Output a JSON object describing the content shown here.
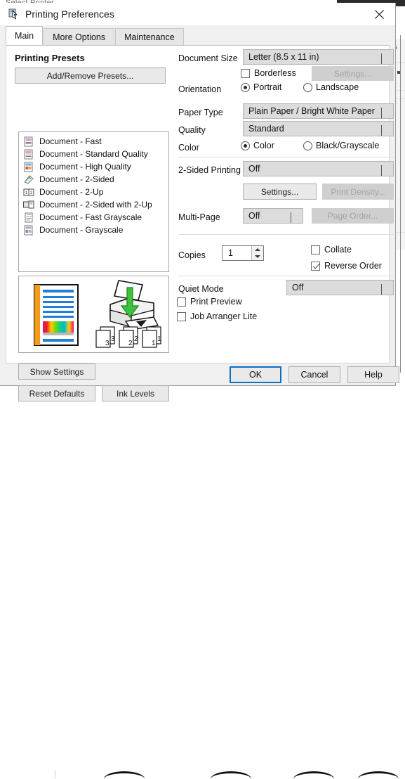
{
  "background": {
    "top_label": "Select Printer",
    "side_glyph": "s"
  },
  "window": {
    "title": "Printing Preferences",
    "title_icon": "printer-icon",
    "close_icon": "close-icon"
  },
  "tabs": [
    {
      "label": "Main",
      "active": true
    },
    {
      "label": "More Options",
      "active": false
    },
    {
      "label": "Maintenance",
      "active": false
    }
  ],
  "left_panel": {
    "section_title": "Printing Presets",
    "add_remove_label": "Add/Remove Presets...",
    "presets": [
      {
        "label": "Document - Fast",
        "icon": "preset-doc-fast-icon"
      },
      {
        "label": "Document - Standard Quality",
        "icon": "preset-doc-standard-icon"
      },
      {
        "label": "Document - High Quality",
        "icon": "preset-doc-high-icon"
      },
      {
        "label": "Document - 2-Sided",
        "icon": "preset-doc-2sided-icon"
      },
      {
        "label": "Document - 2-Up",
        "icon": "preset-doc-2up-icon"
      },
      {
        "label": "Document - 2-Sided with 2-Up",
        "icon": "preset-doc-2sided-2up-icon"
      },
      {
        "label": "Document - Fast Grayscale",
        "icon": "preset-doc-fast-gray-icon"
      },
      {
        "label": "Document - Grayscale",
        "icon": "preset-doc-gray-icon"
      }
    ],
    "preview": {
      "page_labels": [
        "3",
        "3",
        "2",
        "2",
        "1",
        "1"
      ],
      "printer_icon": "printer-illustration",
      "document_icon": "document-preview-illustration"
    },
    "show_settings_label": "Show Settings",
    "reset_defaults_label": "Reset Defaults",
    "ink_levels_label": "Ink Levels"
  },
  "right_panel": {
    "document_size": {
      "label": "Document Size",
      "value": "Letter (8.5 x 11 in)"
    },
    "borderless": {
      "label": "Borderless",
      "checked": false,
      "settings_label": "Settings...",
      "settings_disabled": true
    },
    "orientation": {
      "label": "Orientation",
      "options": [
        {
          "label": "Portrait",
          "selected": true
        },
        {
          "label": "Landscape",
          "selected": false
        }
      ]
    },
    "paper_type": {
      "label": "Paper Type",
      "value": "Plain Paper / Bright White Paper"
    },
    "quality": {
      "label": "Quality",
      "value": "Standard"
    },
    "color": {
      "label": "Color",
      "options": [
        {
          "label": "Color",
          "selected": true
        },
        {
          "label": "Black/Grayscale",
          "selected": false
        }
      ]
    },
    "two_sided": {
      "label": "2-Sided Printing",
      "value": "Off",
      "settings_label": "Settings...",
      "print_density_label": "Print Density...",
      "print_density_disabled": true
    },
    "multi_page": {
      "label": "Multi-Page",
      "value": "Off",
      "page_order_label": "Page Order...",
      "page_order_disabled": true
    },
    "copies": {
      "label": "Copies",
      "value": "1",
      "collate": {
        "label": "Collate",
        "checked": false
      },
      "reverse_order": {
        "label": "Reverse Order",
        "checked": true
      }
    },
    "quiet_mode": {
      "label": "Quiet Mode",
      "value": "Off"
    },
    "print_preview": {
      "label": "Print Preview",
      "checked": false
    },
    "job_arranger": {
      "label": "Job Arranger Lite",
      "checked": false
    }
  },
  "footer": {
    "ok_label": "OK",
    "cancel_label": "Cancel",
    "help_label": "Help"
  },
  "colors": {
    "accent": "#0a6fc2",
    "dialog_bg": "#f0f0f0",
    "combo_bg": "#dcdcdc",
    "disabled_bg": "#cfcfcf"
  }
}
